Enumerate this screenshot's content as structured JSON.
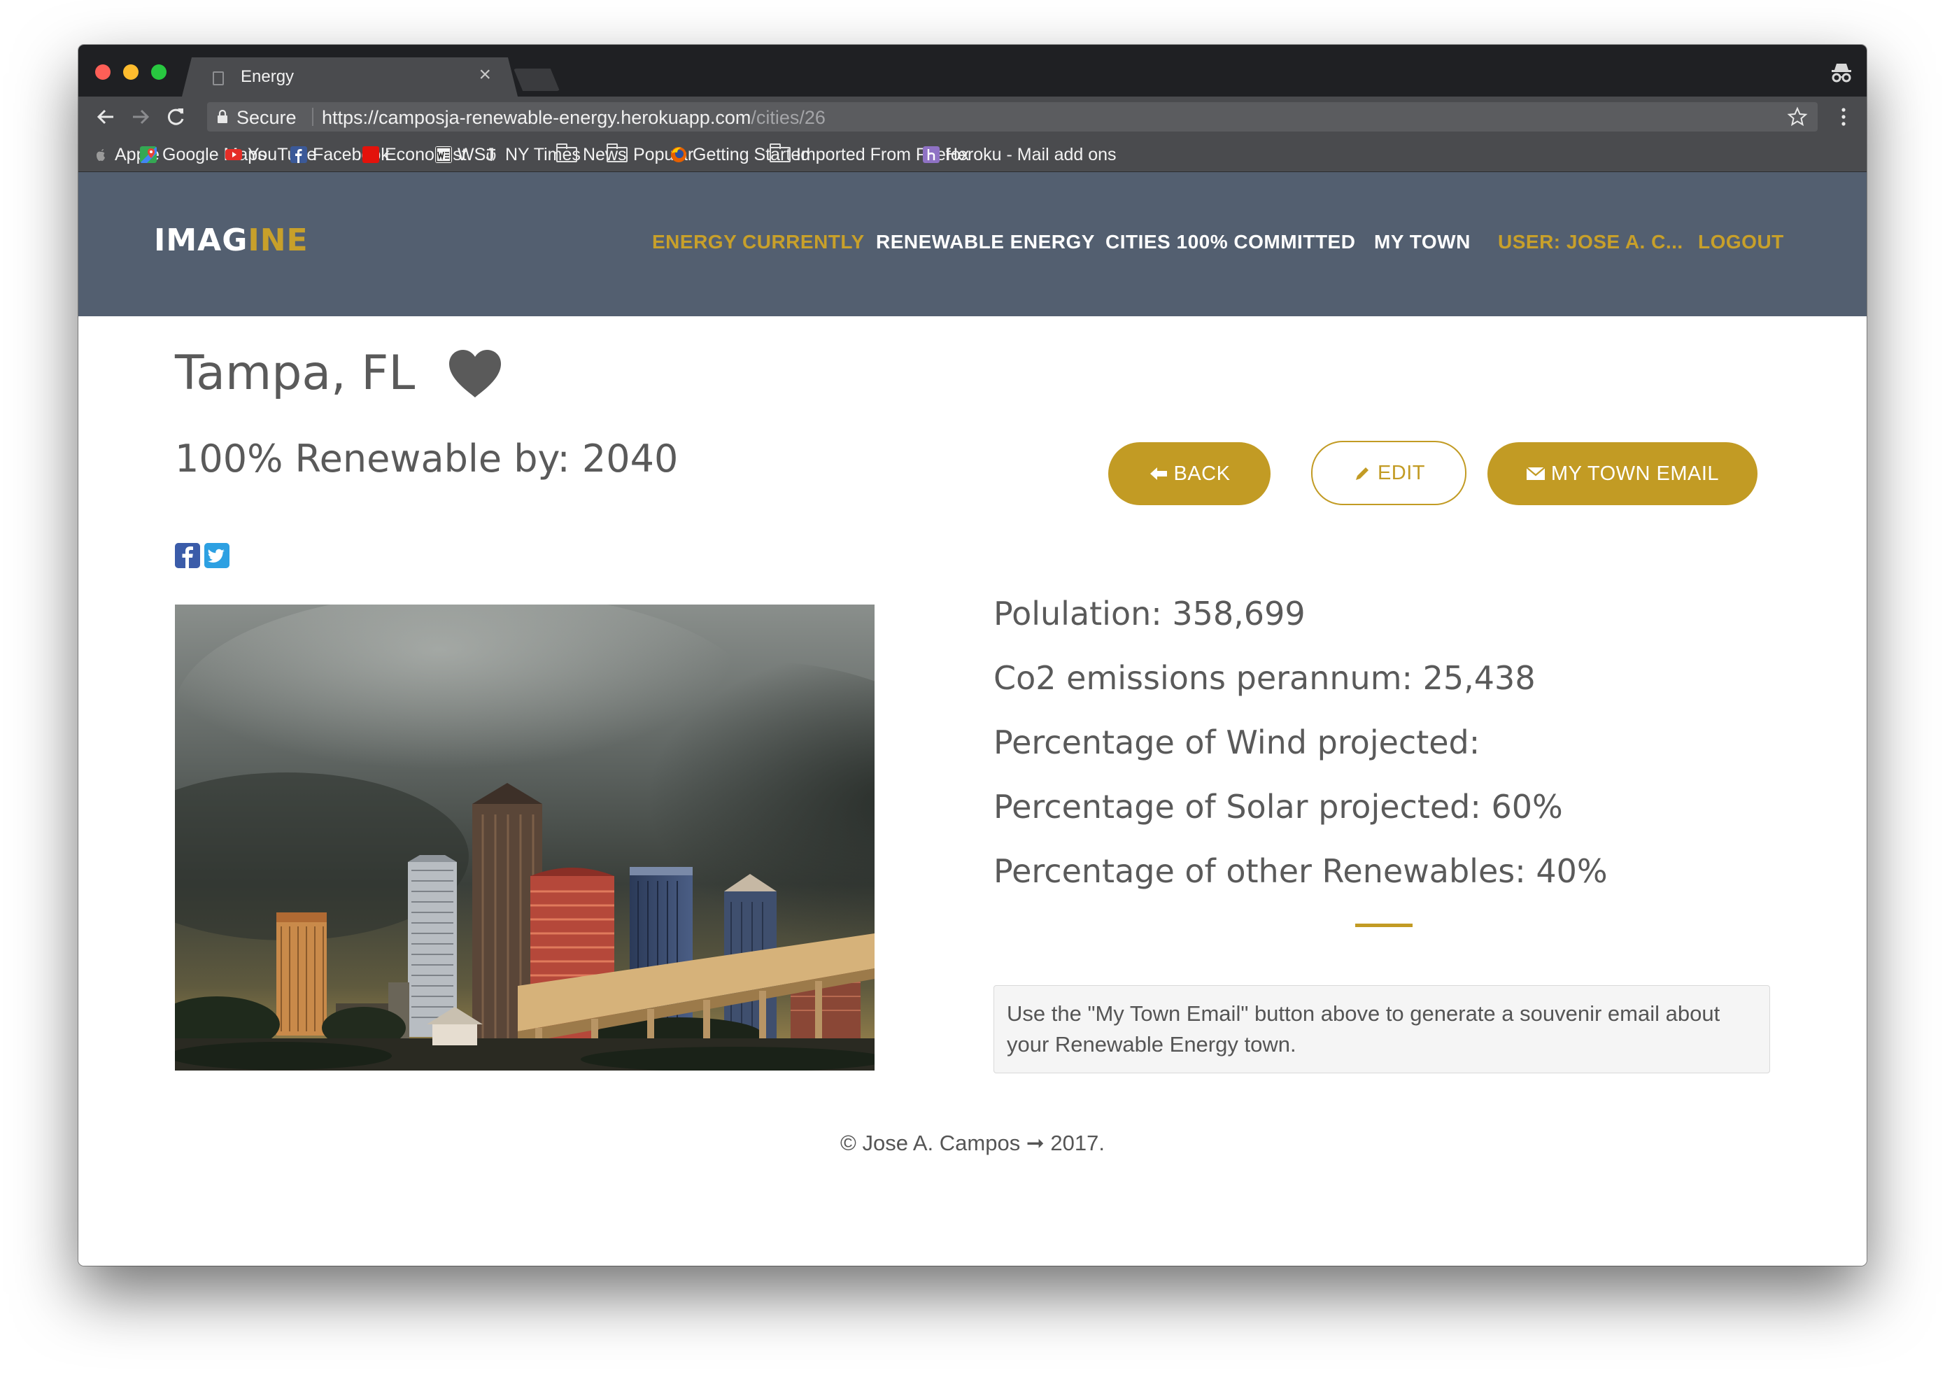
{
  "browser": {
    "tab_title": "Energy",
    "tab_close": "×",
    "secure_label": "Secure",
    "url_base": "https://camposja-renewable-energy.herokuapp.com",
    "url_path": "/cities/26",
    "bookmarks": [
      {
        "label": "Apple",
        "icon": "apple-icon"
      },
      {
        "label": "Google Maps",
        "icon": "google-maps-icon"
      },
      {
        "label": "YouTube",
        "icon": "youtube-icon"
      },
      {
        "label": "Facebook",
        "icon": "facebook-icon"
      },
      {
        "label": "Economist",
        "icon": "economist-icon"
      },
      {
        "label": "WSJ",
        "icon": "wsj-icon"
      },
      {
        "label": "NY Times",
        "icon": "nytimes-icon"
      },
      {
        "label": "News",
        "icon": "folder-icon"
      },
      {
        "label": "Popular",
        "icon": "folder-icon"
      },
      {
        "label": "Getting Started",
        "icon": "firefox-icon"
      },
      {
        "label": "Imported From Firefox",
        "icon": "folder-icon"
      },
      {
        "label": "Heroku - Mail add ons",
        "icon": "heroku-icon"
      }
    ]
  },
  "navbar": {
    "brand_part1": "IMAG",
    "brand_part2": "INE",
    "links": [
      {
        "label": "ENERGY CURRENTLY",
        "color": "#c8a02a"
      },
      {
        "label": "RENEWABLE ENERGY",
        "color": "#ffffff"
      },
      {
        "label": "CITIES 100% COMMITTED",
        "color": "#ffffff"
      },
      {
        "label": "MY TOWN",
        "color": "#ffffff"
      },
      {
        "label": "USER: JOSE A. C...",
        "color": "#c8a02a"
      },
      {
        "label": "LOGOUT",
        "color": "#c8a02a"
      }
    ]
  },
  "city": {
    "title": "Tampa, FL",
    "renewable_target": "100% Renewable by: 2040",
    "stats": [
      "Polulation: 358,699",
      "Co2 emissions perannum: 25,438",
      "Percentage of Wind projected:",
      "Percentage of Solar projected: 60%",
      "Percentage of other Renewables: 40%"
    ],
    "tip": "Use the \"My Town Email\" button above to generate a souvenir email about your Renewable Energy town."
  },
  "actions": {
    "back_label": "BACK",
    "edit_label": "EDIT",
    "email_label": "MY TOWN EMAIL"
  },
  "footer": {
    "text": "© Jose A. Campos ➞ 2017."
  },
  "colors": {
    "navbar_bg": "#535f70",
    "accent_gold": "#c29b24",
    "text_gray": "#5a5a5a"
  }
}
